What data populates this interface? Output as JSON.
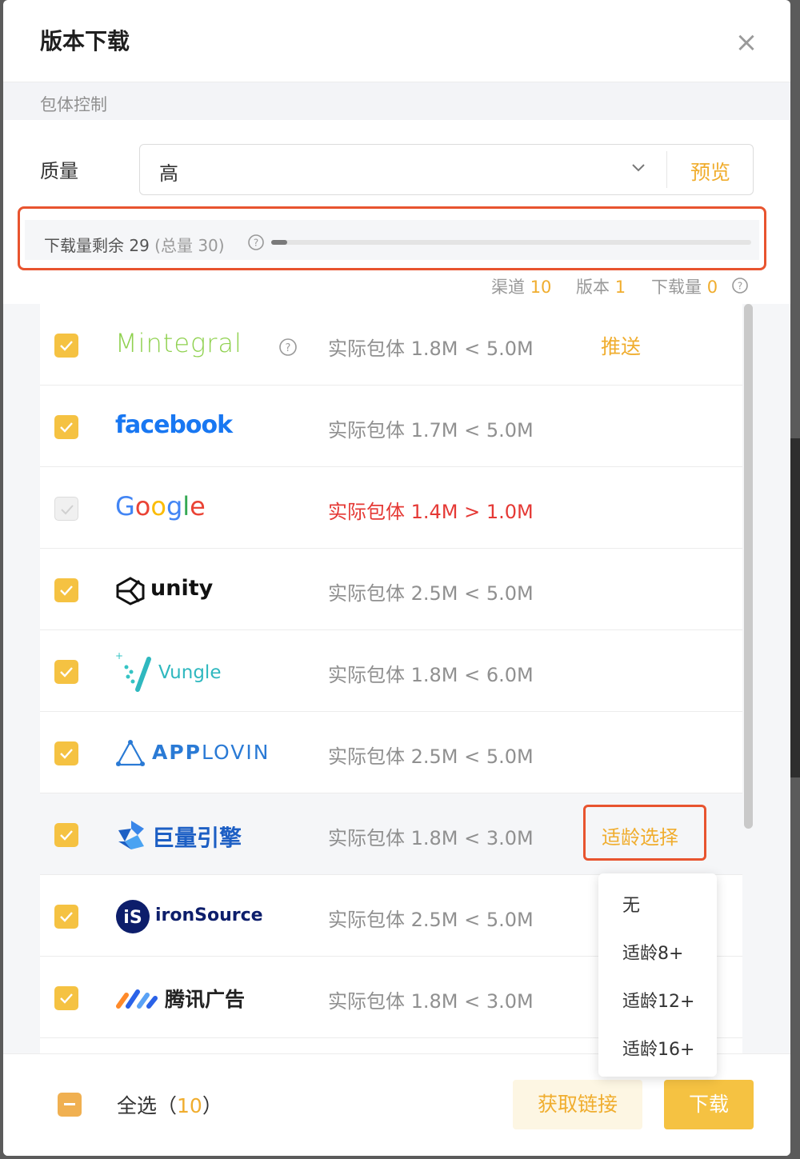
{
  "dialog": {
    "title": "版本下载",
    "close_icon": "close-icon"
  },
  "section": {
    "label": "包体控制"
  },
  "quality": {
    "label": "质量",
    "value": "高",
    "preview_label": "预览"
  },
  "quota": {
    "remaining_text": "下载量剩余 29",
    "total_text": "(总量 30)",
    "used_fraction": 0.033
  },
  "stats": {
    "channels_label": "渠道",
    "channels_value": "10",
    "versions_label": "版本",
    "versions_value": "1",
    "downloads_label": "下载量",
    "downloads_value": "0"
  },
  "rows": [
    {
      "logo": "Mintegral",
      "size": "实际包体 1.8M < 5.0M",
      "checked": true,
      "action": "推送"
    },
    {
      "logo": "facebook",
      "size": "实际包体 1.7M < 5.0M",
      "checked": true
    },
    {
      "logo": "Google",
      "size": "实际包体 1.4M > 1.0M",
      "checked": false,
      "error": true
    },
    {
      "logo": "unity",
      "size": "实际包体 2.5M < 5.0M",
      "checked": true
    },
    {
      "logo": "Vungle",
      "size": "实际包体 1.8M < 6.0M",
      "checked": true
    },
    {
      "logo_a": "APP",
      "logo_b": "LOVIN",
      "size": "实际包体 2.5M < 5.0M",
      "checked": true
    },
    {
      "logo": "巨量引擎",
      "size": "实际包体 1.8M < 3.0M",
      "checked": true,
      "action": "适龄选择"
    },
    {
      "logo_badge": "iS",
      "logo": "ironSource",
      "size": "实际包体 2.5M < 5.0M",
      "checked": true
    },
    {
      "logo": "腾讯广告",
      "size": "实际包体 1.8M < 3.0M",
      "checked": true
    }
  ],
  "age_options": [
    "无",
    "适龄8+",
    "适龄12+",
    "适龄16+"
  ],
  "footer": {
    "select_all_label": "全选（",
    "select_all_count": "10",
    "select_all_close": "）",
    "get_link_label": "获取链接",
    "download_label": "下载"
  },
  "colors": {
    "accent": "#f5c242",
    "accent_text": "#f0ad2e",
    "error": "#e53935",
    "highlight_border": "#e8542f"
  }
}
